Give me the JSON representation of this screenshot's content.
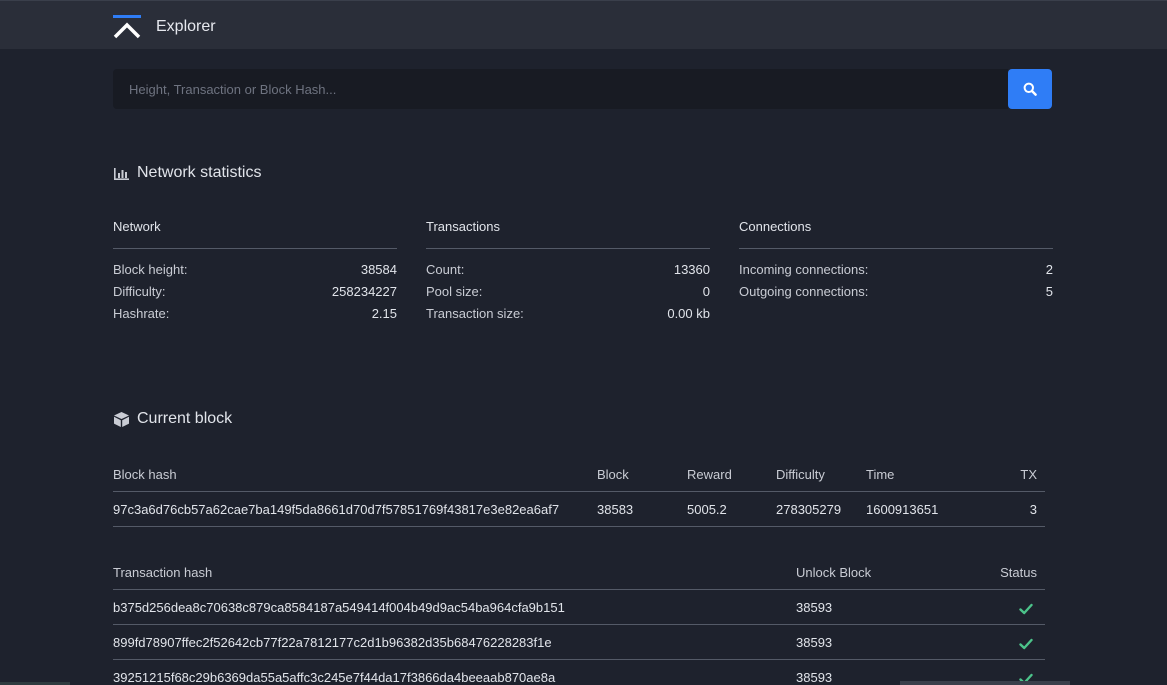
{
  "header": {
    "title": "Explorer"
  },
  "search": {
    "placeholder": "Height, Transaction or Block Hash..."
  },
  "network_statistics": {
    "title": "Network statistics",
    "columns": [
      {
        "heading": "Network",
        "rows": [
          {
            "label": "Block height:",
            "value": "38584"
          },
          {
            "label": "Difficulty:",
            "value": "258234227"
          },
          {
            "label": "Hashrate:",
            "value": "2.15"
          }
        ]
      },
      {
        "heading": "Transactions",
        "rows": [
          {
            "label": "Count:",
            "value": "13360"
          },
          {
            "label": "Pool size:",
            "value": "0"
          },
          {
            "label": "Transaction size:",
            "value": "0.00 kb"
          }
        ]
      },
      {
        "heading": "Connections",
        "rows": [
          {
            "label": "Incoming connections:",
            "value": "2"
          },
          {
            "label": "Outgoing connections:",
            "value": "5"
          }
        ]
      }
    ]
  },
  "current_block": {
    "title": "Current block",
    "headers": {
      "hash": "Block hash",
      "block": "Block",
      "reward": "Reward",
      "difficulty": "Difficulty",
      "time": "Time",
      "tx": "TX"
    },
    "row": {
      "hash": "97c3a6d76cb57a62cae7ba149f5da8661d70d7f57851769f43817e3e82ea6af7",
      "block": "38583",
      "reward": "5005.2",
      "difficulty": "278305279",
      "time": "1600913651",
      "tx": "3"
    }
  },
  "transactions": {
    "headers": {
      "hash": "Transaction hash",
      "unlock": "Unlock Block",
      "status": "Status"
    },
    "rows": [
      {
        "hash": "b375d256dea8c70638c879ca8584187a549414f004b49d9ac54ba964cfa9b151",
        "unlock": "38593",
        "status": "confirmed"
      },
      {
        "hash": "899fd78907ffec2f52642cb77f22a7812177c2d1b96382d35b68476228283f1e",
        "unlock": "38593",
        "status": "confirmed"
      },
      {
        "hash": "39251215f68c29b6369da55a5affc3c245e7f44da17f3866da4beeaab870ae8a",
        "unlock": "38593",
        "status": "confirmed"
      }
    ]
  },
  "colors": {
    "accent": "#2f7df6",
    "success": "#4cc38a",
    "background": "#1e222d",
    "topbar": "#2a2e39"
  }
}
